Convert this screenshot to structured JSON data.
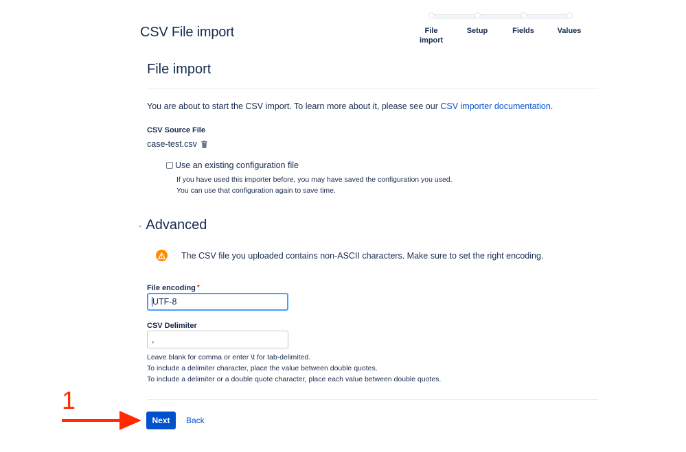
{
  "header": {
    "title": "CSV File import"
  },
  "progress_tracker": {
    "steps": [
      {
        "label": "File import"
      },
      {
        "label": "Setup"
      },
      {
        "label": "Fields"
      },
      {
        "label": "Values"
      }
    ],
    "current_step": 1
  },
  "file_import": {
    "title": "File import",
    "intro_text": "You are about to start the CSV import. To learn more about it, please see our ",
    "intro_link": "CSV importer documentation",
    "intro_suffix": ".",
    "source_label": "CSV Source File",
    "source_file": "case-test.csv",
    "delete_icon": "trash-icon",
    "config_checkbox": {
      "label": "Use an existing configuration file",
      "checked": false,
      "help_line1": "If you have used this importer before, you may have saved the configuration you used.",
      "help_line2": "You can use that configuration again to save time."
    }
  },
  "advanced": {
    "title": "Advanced",
    "expanded": true,
    "warning_icon": "warning-icon",
    "warning_text": "The CSV file you uploaded contains non-ASCII characters. Make sure to set the right encoding.",
    "encoding": {
      "label": "File encoding",
      "required_mark": "*",
      "value": "UTF-8"
    },
    "delimiter": {
      "label": "CSV Delimiter",
      "value": ",",
      "help": [
        "Leave blank for comma or enter \\t for tab-delimited.",
        "To include a delimiter character, place the value between double quotes.",
        "To include a delimiter or a double quote character, place each value between double quotes."
      ]
    }
  },
  "actions": {
    "next_label": "Next",
    "back_label": "Back"
  },
  "annotation": {
    "step_number": "1",
    "color": "#ff2a00"
  },
  "colors": {
    "primary": "#0052cc",
    "text": "#172b4d",
    "warning": "#ff8b00",
    "focus": "#4c9aff"
  }
}
